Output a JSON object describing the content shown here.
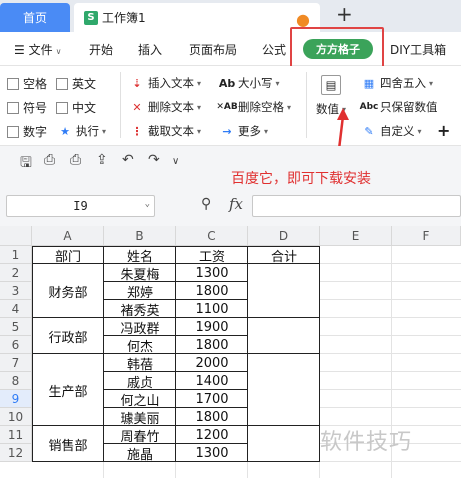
{
  "tabs": {
    "home": "首页",
    "doc": "工作簿1",
    "doc_icon": "S"
  },
  "menu": {
    "file": "文件",
    "items": [
      "开始",
      "插入",
      "页面布局",
      "公式",
      "方方格子",
      "DIY工具箱"
    ]
  },
  "ribbon": {
    "checkboxes": [
      "空格",
      "英文",
      "符号",
      "中文",
      "数字"
    ],
    "exec": "执行",
    "col2": [
      "插入文本",
      "删除文本",
      "截取文本"
    ],
    "col3": [
      "大小写",
      "删除空格",
      "更多"
    ],
    "numeric": "数值",
    "col5": [
      "四舍五入",
      "只保留数值",
      "自定义"
    ],
    "plus": "+"
  },
  "annotation": "百度它，即可下载安装",
  "formula": {
    "cell_ref": "I9",
    "fx": "fx",
    "value": ""
  },
  "sheet": {
    "columns": [
      "A",
      "B",
      "C",
      "D",
      "E",
      "F"
    ],
    "rows": [
      "1",
      "2",
      "3",
      "4",
      "5",
      "6",
      "7",
      "8",
      "9",
      "10",
      "11",
      "12"
    ],
    "selected_row": "9",
    "headers": [
      "部门",
      "姓名",
      "工资",
      "合计"
    ],
    "departments": [
      "财务部",
      "行政部",
      "生产部",
      "销售部"
    ],
    "names": [
      "朱夏梅",
      "郑婷",
      "褚秀英",
      "冯政群",
      "何杰",
      "韩蓓",
      "戚贞",
      "何之山",
      "璩美丽",
      "周春竹",
      "施晶"
    ],
    "salaries": [
      "1300",
      "1800",
      "1100",
      "1900",
      "1800",
      "2000",
      "1400",
      "1700",
      "1800",
      "1200",
      "1300"
    ]
  },
  "watermark": "软件技巧"
}
